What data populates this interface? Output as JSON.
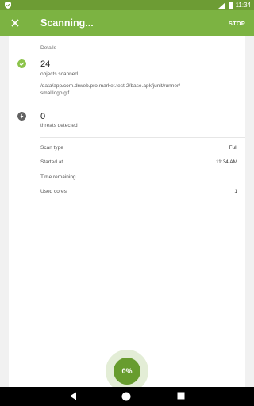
{
  "status_bar": {
    "time": "11:34"
  },
  "app_bar": {
    "title": "Scanning...",
    "stop_label": "STOP"
  },
  "details": {
    "section_label": "Details",
    "scanned": {
      "count": "24",
      "label": "objects scanned",
      "path_line1": "/data/app/com.drweb.pro.market.test-2/base.apk/junit/runner/",
      "path_line2": "smalllogo.gif"
    },
    "threats": {
      "count": "0",
      "label": "threats detected"
    },
    "info_rows": [
      {
        "key": "Scan type",
        "value": "Full"
      },
      {
        "key": "Started at",
        "value": "11:34 AM"
      },
      {
        "key": "Time remaining",
        "value": ""
      },
      {
        "key": "Used cores",
        "value": "1"
      }
    ]
  },
  "progress": {
    "value": "0%",
    "fraction": 0
  },
  "colors": {
    "status_bar": "#6d9c34",
    "app_bar": "#7cb342",
    "fab": "#679c2e",
    "check": "#8bc34a",
    "threat_icon": "#616161"
  }
}
